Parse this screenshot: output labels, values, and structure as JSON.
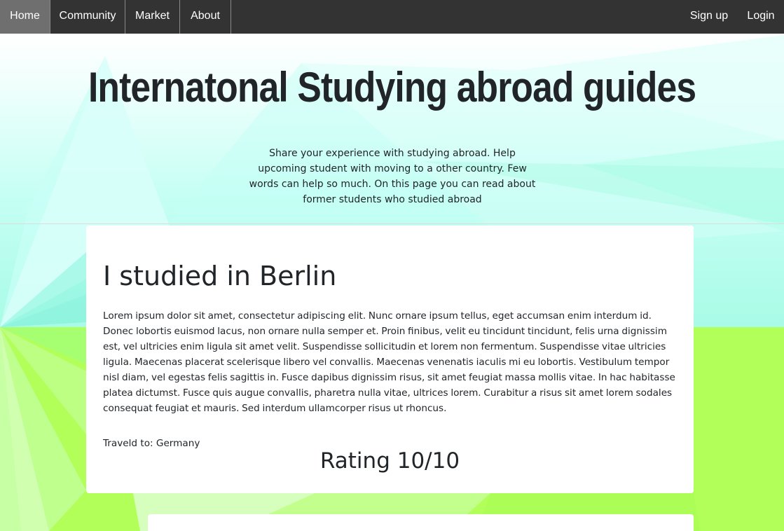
{
  "nav": {
    "left": [
      "Home",
      "Community",
      "Market",
      "About"
    ],
    "right": [
      "Sign up",
      "Login"
    ],
    "active": "Home"
  },
  "hero": {
    "title": "Internatonal Studying abroad guides",
    "text": "Share your experience with studying abroad. Help upcoming student with moving to a other country. Few words can help so much. On this page you can read about former students who studied abroad"
  },
  "post": {
    "title": "I studied in Berlin",
    "body": "Lorem ipsum dolor sit amet, consectetur adipiscing elit. Nunc ornare ipsum tellus, eget accumsan enim interdum id. Donec lobortis euismod lacus, non ornare nulla semper et. Proin finibus, velit eu tincidunt tincidunt, felis urna dignissim est, vel ultricies enim ligula sit amet velit. Suspendisse sollicitudin et lorem non fermentum. Suspendisse vitae ultricies ligula. Maecenas placerat scelerisque libero vel convallis. Maecenas venenatis iaculis mi eu lobortis. Vestibulum tempor nisl diam, vel egestas felis sagittis in. Fusce dapibus dignissim risus, sit amet feugiat massa mollis vitae. In hac habitasse platea dictumst. Fusce quis augue convallis, pharetra nulla vitae, ultrices lorem. Curabitur a risus sit amet lorem sodales consequat feugiat et mauris. Sed interdum ullamcorper risus ut rhoncus.",
    "travel": "Traveld to: Germany",
    "rating": "Rating 10/10"
  },
  "colors": {
    "navbar": "#333333",
    "nav_active": "#6f6f6f",
    "bg_cyan": "#a8fbe6",
    "bg_green": "#b3ff5a",
    "text": "#212529"
  }
}
